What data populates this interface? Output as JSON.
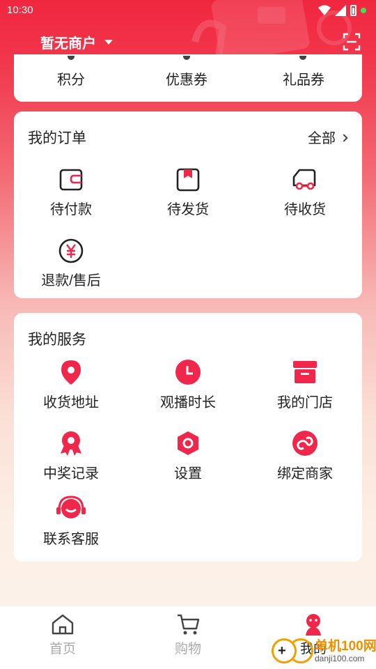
{
  "status_bar": {
    "time": "10:30"
  },
  "header": {
    "merchant_label": "暂无商户"
  },
  "assets": [
    {
      "label": "积分"
    },
    {
      "label": "优惠券"
    },
    {
      "label": "礼品券"
    }
  ],
  "orders": {
    "title": "我的订单",
    "all_label": "全部",
    "items": [
      {
        "label": "待付款",
        "icon": "wallet-icon"
      },
      {
        "label": "待发货",
        "icon": "package-icon"
      },
      {
        "label": "待收货",
        "icon": "truck-icon"
      },
      {
        "label": "退款/售后",
        "icon": "yen-icon"
      }
    ]
  },
  "services": {
    "title": "我的服务",
    "items": [
      {
        "label": "收货地址",
        "icon": "location-icon"
      },
      {
        "label": "观播时长",
        "icon": "clock-icon"
      },
      {
        "label": "我的门店",
        "icon": "store-icon"
      },
      {
        "label": "中奖记录",
        "icon": "award-icon"
      },
      {
        "label": "设置",
        "icon": "settings-icon"
      },
      {
        "label": "绑定商家",
        "icon": "link-icon"
      },
      {
        "label": "联系客服",
        "icon": "headset-icon"
      }
    ]
  },
  "bottom_nav": [
    {
      "label": "首页",
      "icon": "home-icon"
    },
    {
      "label": "购物",
      "icon": "cart-icon"
    },
    {
      "label": "我的",
      "icon": "profile-icon"
    }
  ],
  "watermark": {
    "title": "单机100网",
    "url": "danji100.com"
  },
  "colors": {
    "brand_red": "#f0264a",
    "text": "#222222",
    "inactive": "#aaaaaa"
  }
}
